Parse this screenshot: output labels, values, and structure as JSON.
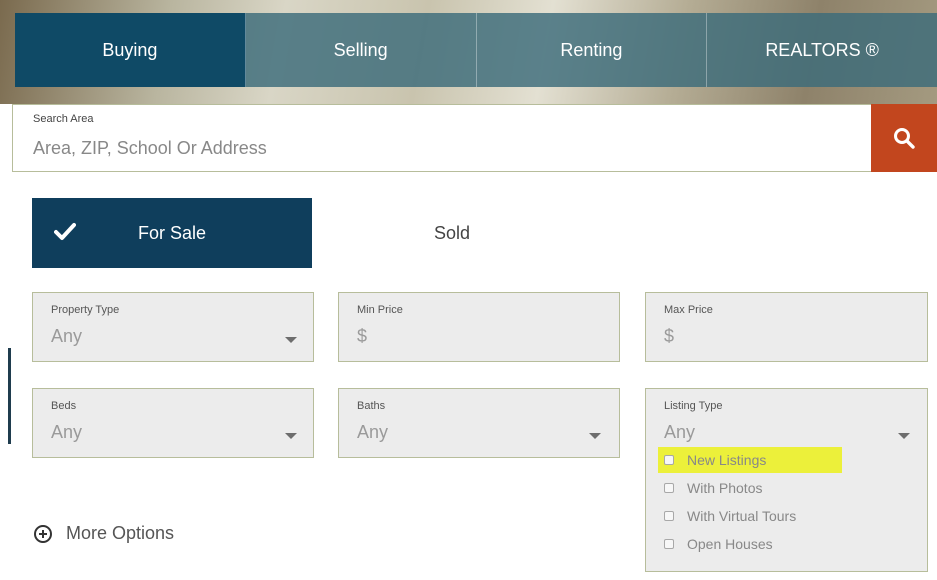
{
  "nav": {
    "tabs": [
      {
        "label": "Buying",
        "active": true
      },
      {
        "label": "Selling",
        "active": false
      },
      {
        "label": "Renting",
        "active": false
      },
      {
        "label": "REALTORS ®",
        "active": false
      }
    ]
  },
  "search": {
    "label": "Search Area",
    "placeholder": "Area, ZIP, School Or Address",
    "value": "",
    "button_icon": "search-icon"
  },
  "status": {
    "options": [
      {
        "label": "For Sale",
        "active": true,
        "icon": "check-icon"
      },
      {
        "label": "Sold",
        "active": false
      }
    ]
  },
  "filters": {
    "property_type": {
      "label": "Property Type",
      "value": "Any"
    },
    "min_price": {
      "label": "Min Price",
      "value": "$"
    },
    "max_price": {
      "label": "Max Price",
      "value": "$"
    },
    "beds": {
      "label": "Beds",
      "value": "Any"
    },
    "baths": {
      "label": "Baths",
      "value": "Any"
    },
    "listing_type": {
      "label": "Listing Type",
      "value": "Any",
      "options": [
        {
          "label": "New Listings",
          "checked": false,
          "highlighted": true
        },
        {
          "label": "With Photos",
          "checked": false
        },
        {
          "label": "With Virtual Tours",
          "checked": false
        },
        {
          "label": "Open Houses",
          "checked": false
        }
      ]
    }
  },
  "more_options": {
    "label": "More Options",
    "icon": "plus-circle-icon"
  },
  "colors": {
    "nav_active": "#0f4a66",
    "nav_inactive": "#3c6b7a",
    "status_active": "#0f3e5c",
    "search_button": "#c2461e",
    "highlight": "#ecf03a",
    "field_border": "#b7bd9b"
  }
}
